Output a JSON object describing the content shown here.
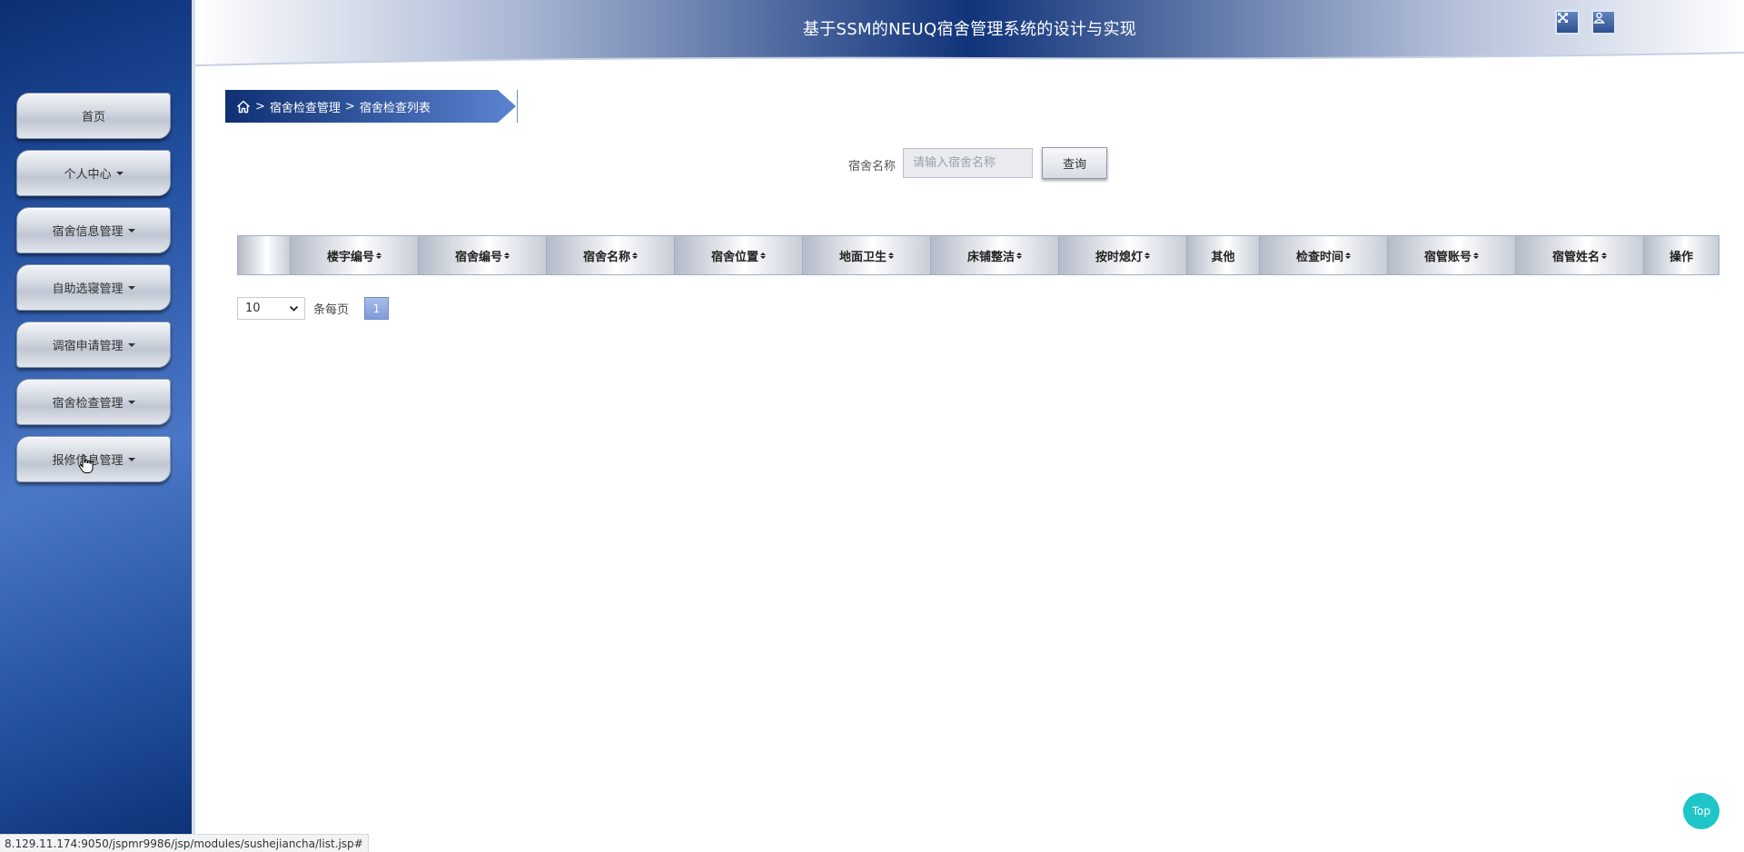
{
  "header": {
    "title": "基于SSM的NEUQ宿舍管理系统的设计与实现",
    "icons": [
      "fullscreen-icon",
      "user-icon"
    ]
  },
  "sidebar": {
    "items": [
      {
        "label": "首页",
        "has_dropdown": false
      },
      {
        "label": "个人中心",
        "has_dropdown": true
      },
      {
        "label": "宿舍信息管理",
        "has_dropdown": true
      },
      {
        "label": "自助选寝管理",
        "has_dropdown": true
      },
      {
        "label": "调宿申请管理",
        "has_dropdown": true
      },
      {
        "label": "宿舍检查管理",
        "has_dropdown": true
      },
      {
        "label": "报修信息管理",
        "has_dropdown": true
      }
    ]
  },
  "breadcrumb": {
    "home_icon": "home-icon",
    "separator": ">",
    "items": [
      "宿舍检查管理",
      "宿舍检查列表"
    ]
  },
  "search": {
    "label": "宿舍名称",
    "placeholder": "请输入宿舍名称",
    "value": "",
    "button_label": "查询"
  },
  "table": {
    "columns": [
      {
        "label": "",
        "sortable": false
      },
      {
        "label": "楼宇编号",
        "sortable": true
      },
      {
        "label": "宿舍编号",
        "sortable": true
      },
      {
        "label": "宿舍名称",
        "sortable": true
      },
      {
        "label": "宿舍位置",
        "sortable": true
      },
      {
        "label": "地面卫生",
        "sortable": true
      },
      {
        "label": "床铺整洁",
        "sortable": true
      },
      {
        "label": "按时熄灯",
        "sortable": true
      },
      {
        "label": "其他",
        "sortable": false
      },
      {
        "label": "检查时间",
        "sortable": true
      },
      {
        "label": "宿管账号",
        "sortable": true
      },
      {
        "label": "宿管姓名",
        "sortable": true
      },
      {
        "label": "操作",
        "sortable": false
      }
    ],
    "rows": []
  },
  "pagination": {
    "page_size": "10",
    "per_page_label": "条每页",
    "current_page": "1"
  },
  "top_button_label": "Top",
  "status_url": "8.129.11.174:9050/jspmr9986/jsp/modules/sushejiancha/list.jsp#",
  "colors": {
    "sidebar_dark": "#0b2f73",
    "sidebar_light": "#4b78c6",
    "top_button": "#1ec5c9",
    "page_active": "#7f9bd8"
  }
}
